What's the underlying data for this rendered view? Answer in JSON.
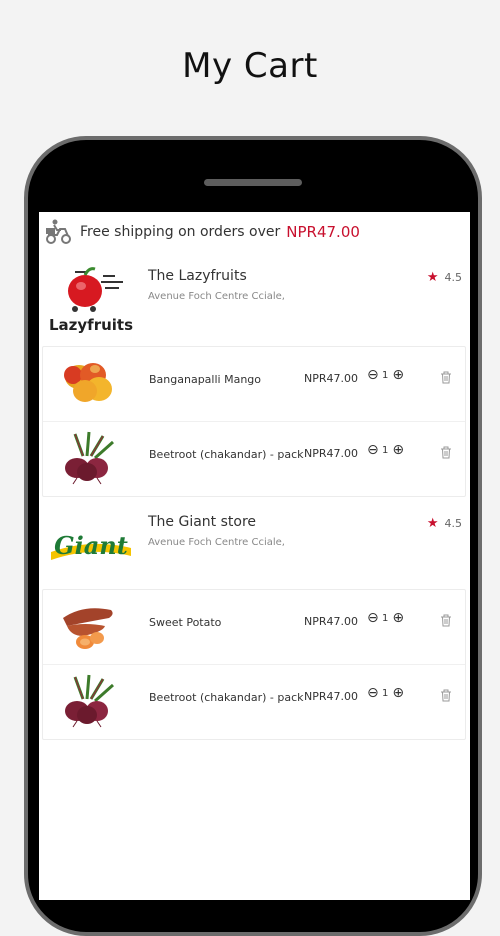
{
  "header": {
    "title": "My Cart"
  },
  "shipping": {
    "text": "Free shipping on orders over",
    "amount": "NPR47.00"
  },
  "stores": [
    {
      "name": "The Lazyfruits",
      "address": "Avenue Foch Centre Cciale,",
      "rating": "4.5",
      "logo_text": "Lazyfruits",
      "items": [
        {
          "name": "Banganapalli Mango",
          "price": "NPR47.00",
          "qty": "1",
          "image": "mango-image"
        },
        {
          "name": "Beetroot (chakandar) - pack",
          "price": "NPR47.00",
          "qty": "1",
          "image": "beetroot-image"
        }
      ]
    },
    {
      "name": "The Giant store",
      "address": "Avenue Foch Centre Cciale,",
      "rating": "4.5",
      "logo_text": "Giant",
      "items": [
        {
          "name": "Sweet Potato",
          "price": "NPR47.00",
          "qty": "1",
          "image": "sweet-potato-image"
        },
        {
          "name": "Beetroot (chakandar) - pack",
          "price": "NPR47.00",
          "qty": "1",
          "image": "beetroot-image"
        }
      ]
    }
  ],
  "colors": {
    "accent": "#c8102e",
    "giant_green": "#1e7a36",
    "giant_yellow": "#f5c400"
  },
  "icons": {
    "minus": "⊖",
    "plus": "⊕",
    "star": "★"
  }
}
